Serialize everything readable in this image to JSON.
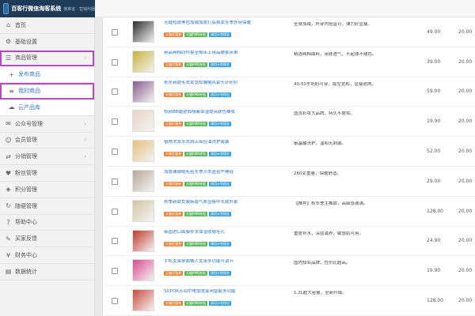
{
  "header": {
    "title": "百客行微信淘客系统",
    "subtitle": "微推客 · 营销利器"
  },
  "sidebar": {
    "items": [
      {
        "label": "首页",
        "icon": "home-icon",
        "glyph": "⌂"
      },
      {
        "label": "基础设置",
        "icon": "gear-icon",
        "glyph": "⚙"
      },
      {
        "label": "商品管理",
        "icon": "list-icon",
        "glyph": "☰",
        "arrow": "›"
      },
      {
        "label": "发布商品",
        "icon": "plus-icon",
        "glyph": "+",
        "sub": true
      },
      {
        "label": "我的商品",
        "icon": "list-icon",
        "glyph": "≡",
        "sub": true
      },
      {
        "label": "云产品库",
        "icon": "cloud-icon",
        "glyph": "☁",
        "sub": true
      },
      {
        "label": "公众号管理",
        "icon": "chat-icon",
        "glyph": "✉",
        "arrow": "›"
      },
      {
        "label": "会员管理",
        "icon": "users-icon",
        "glyph": "☺",
        "arrow": "›"
      },
      {
        "label": "分销管理",
        "icon": "share-icon",
        "glyph": "⇄",
        "arrow": "›"
      },
      {
        "label": "粉丝管理",
        "icon": "fans-icon",
        "glyph": "♥"
      },
      {
        "label": "积分管理",
        "icon": "points-icon",
        "glyph": "◈"
      },
      {
        "label": "随便管理",
        "icon": "random-icon",
        "glyph": "↻"
      },
      {
        "label": "帮助中心",
        "icon": "help-icon",
        "glyph": "?"
      },
      {
        "label": "买家反馈",
        "icon": "feedback-icon",
        "glyph": "✎"
      },
      {
        "label": "财务中心",
        "icon": "finance-icon",
        "glyph": "¥"
      },
      {
        "label": "数据统计",
        "icon": "stats-icon",
        "glyph": "▤"
      }
    ]
  },
  "products": [
    {
      "title": "无缝短款黑色加绒加厚打底裤女冬季外穿保暖",
      "desc": "全身加绒，外穿内搭皆可，弹力好显瘦。",
      "price": "49.00",
      "pct": "20.00",
      "thumb": "#2d2d2d"
    },
    {
      "title": "新品纯棉四件套全棉床上用品被套床单",
      "desc": "精选纯棉面料，亲肤透气，不起球不褪色。",
      "price": "39.00",
      "pct": "20.00",
      "thumb": "#c9b03a"
    },
    {
      "title": "秋冬新款毛衣女宽松慵懒风套头针织衫",
      "desc": "40-50岁妈妈可穿，版型宽松，显瘦遮肉。",
      "price": "59.00",
      "pct": "20.00",
      "thumb": "#8a5a8f"
    },
    {
      "title": "修颜BB霜遮瑕隔离保湿提亮肤色裸妆",
      "desc": "国货彩妆大品牌，持久不脱妆。",
      "price": "19.90",
      "pct": "20.00",
      "thumb": "#e9d3c4"
    },
    {
      "title": "植物洗发水去屑止痒控油洗护套装",
      "desc": "氨基酸洗护，温和无刺激。",
      "price": "52.00",
      "pct": "20.00",
      "thumb": "#e6c07b"
    },
    {
      "title": "加厚珊瑚绒毛毯冬季沙发盖毯午睡毯",
      "desc": "260克重量，保暖舒适。",
      "price": "29.00",
      "pct": "20.00",
      "thumb": "#b7a79a"
    },
    {
      "title": "秋季新款女装韩版气质显瘦中长款外套",
      "desc": "【推荐】秋冬季主推款，高级感满满。",
      "price": "128.00",
      "pct": "20.00",
      "thumb": "#d4c6a6"
    },
    {
      "title": "韩国进口面膜补水保湿收缩毛孔",
      "desc": "重度补水，深层滋养，敏感肌可用。",
      "price": "24.90",
      "pct": "20.00",
      "thumb": "#c0392b"
    },
    {
      "title": "手机支架桌面懒人支架多功能可调节",
      "desc": "国内知名品牌，性价比超高。",
      "price": "19.90",
      "pct": "20.00",
      "thumb": "#d94c8f"
    },
    {
      "title": "SUPOR苏泊尔电饭煲家用智能多功能",
      "desc": "1.2L超大容量，全新升级。",
      "price": "128.00",
      "pct": "20.00",
      "thumb": "#c94b3b"
    }
  ],
  "tags": [
    "天猫优惠券",
    "天猫RMB补贴",
    "通用计划佣金"
  ],
  "colors": {
    "accent": "#2a73c4",
    "highlight": "#b44ac0",
    "tag_orange": "#e9843a",
    "tag_green": "#5cb85c",
    "tag_blue": "#3aa0d9"
  }
}
